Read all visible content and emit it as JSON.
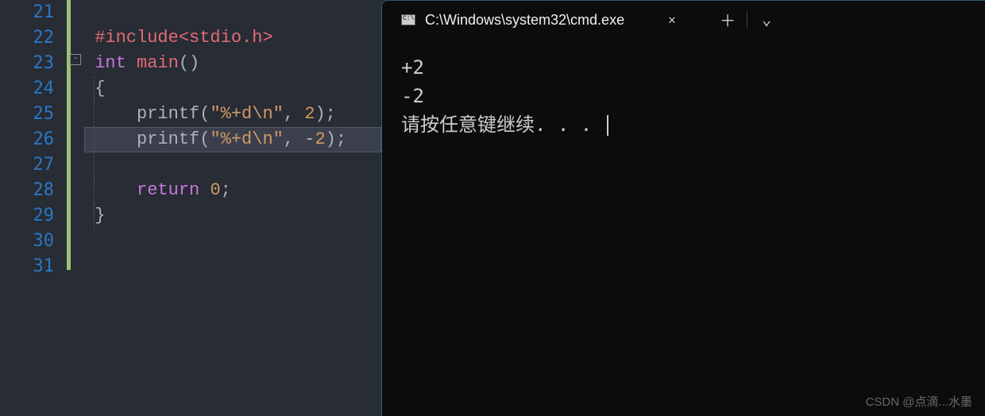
{
  "editor": {
    "line_numbers": [
      "21",
      "22",
      "23",
      "24",
      "25",
      "26",
      "27",
      "28",
      "29",
      "30",
      "31"
    ],
    "fold_icon": "-",
    "code": {
      "l22_include": "#include",
      "l22_header": "<stdio.h>",
      "l23_type": "int",
      "l23_main": " main",
      "l23_paren": "()",
      "l24_brace": "{",
      "l25_printf": "printf",
      "l25_open": "(",
      "l25_str": "\"%+d\\n\"",
      "l25_comma": ", ",
      "l25_num": "2",
      "l25_close": ");",
      "l26_printf": "printf",
      "l26_open": "(",
      "l26_str": "\"%+d\\n\"",
      "l26_comma": ", ",
      "l26_neg": "-",
      "l26_num": "2",
      "l26_close": ");",
      "l28_return": "return",
      "l28_sp": " ",
      "l28_num": "0",
      "l28_semi": ";",
      "l29_brace": "}"
    }
  },
  "terminal": {
    "tab_title": "C:\\Windows\\system32\\cmd.exe",
    "tab_icon": "C:\\",
    "close": "✕",
    "add": "＋",
    "dropdown": "⌄",
    "output": {
      "line1": "+2",
      "line2": "-2",
      "line3": "请按任意键继续. . . "
    }
  },
  "watermark": "CSDN @点滴...水墨"
}
